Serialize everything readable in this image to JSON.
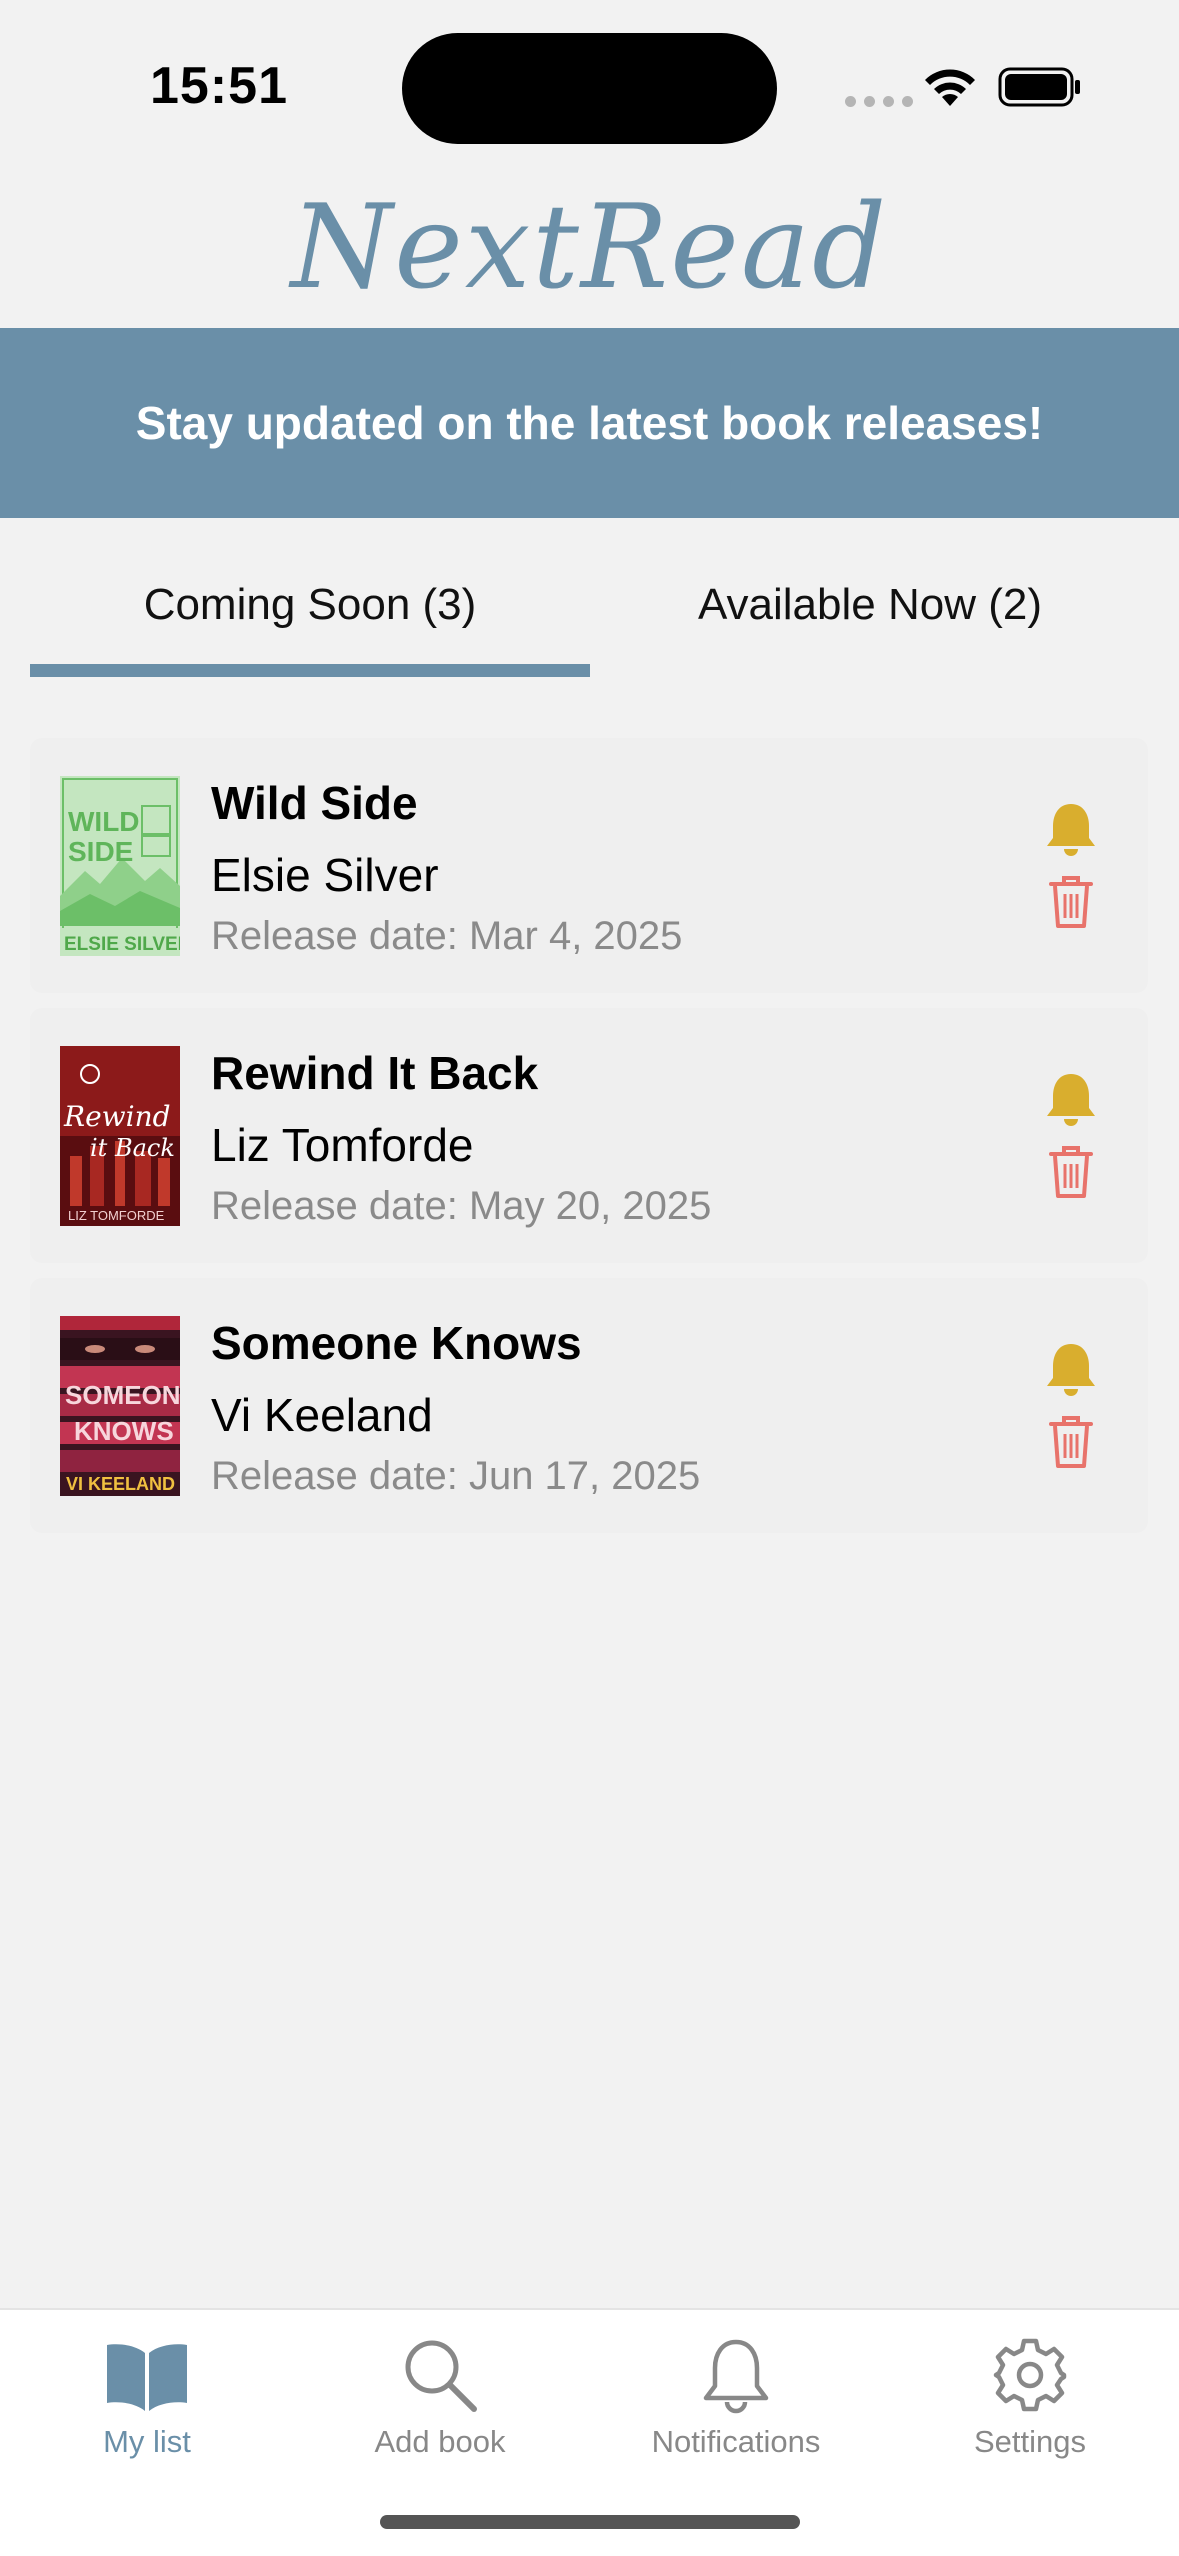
{
  "status_bar": {
    "time": "15:51"
  },
  "app": {
    "logo": "NextRead"
  },
  "banner": {
    "text": "Stay updated on the latest book releases!"
  },
  "tabs": [
    {
      "label": "Coming Soon (3)",
      "active": true
    },
    {
      "label": "Available Now (2)",
      "active": false
    }
  ],
  "books": [
    {
      "title": "Wild Side",
      "author": "Elsie Silver",
      "release": "Release date: Mar 4, 2025",
      "cover_text": [
        "WILD",
        "SIDE",
        "ELSIE SILVER"
      ]
    },
    {
      "title": "Rewind It Back",
      "author": "Liz Tomforde",
      "release": "Release date: May 20, 2025",
      "cover_text": [
        "Rewind",
        "it Back",
        "LIZ TOMFORDE"
      ]
    },
    {
      "title": "Someone Knows",
      "author": "Vi Keeland",
      "release": "Release date: Jun 17, 2025",
      "cover_text": [
        "SOMEONE",
        "KNOWS",
        "VI KEELAND"
      ]
    }
  ],
  "tabbar": [
    {
      "label": "My list",
      "icon": "book-icon",
      "active": true
    },
    {
      "label": "Add book",
      "icon": "search-icon",
      "active": false
    },
    {
      "label": "Notifications",
      "icon": "bell-icon",
      "active": false
    },
    {
      "label": "Settings",
      "icon": "gear-icon",
      "active": false
    }
  ],
  "colors": {
    "accent": "#6a8fa8",
    "bell": "#d9ae2e",
    "trash": "#e8736b",
    "background": "#f2f2f2"
  }
}
